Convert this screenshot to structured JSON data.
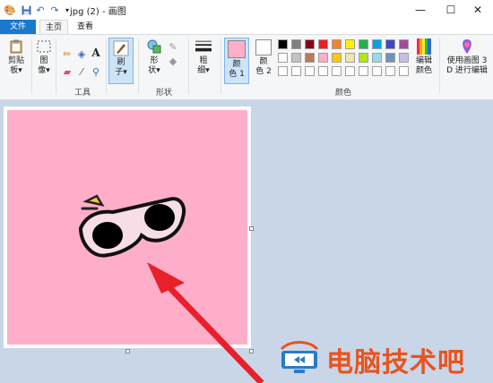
{
  "window": {
    "title": "jpg (2) - 画图",
    "quick_access": [
      "paint-app-icon",
      "save-icon",
      "undo-icon",
      "redo-icon",
      "customize-dropdown-icon"
    ]
  },
  "tabs": [
    {
      "label": "文件"
    },
    {
      "label": "主页"
    },
    {
      "label": "查看"
    }
  ],
  "ribbon": {
    "clipboard": {
      "paste_line1": "剪贴",
      "paste_line2": "板▾"
    },
    "image": {
      "line1": "图",
      "line2": "像▾"
    },
    "tools": {
      "label": "工具",
      "text_tool": "A"
    },
    "brushes": {
      "line1": "刷",
      "line2": "子▾"
    },
    "shapes": {
      "line1": "形",
      "line2": "状▾",
      "label": "形状"
    },
    "size": {
      "line1": "粗",
      "line2": "细▾"
    },
    "color1": {
      "line1": "颜",
      "line2": "色 1",
      "value": "#ffaec9"
    },
    "color2": {
      "line1": "颜",
      "line2": "色 2",
      "value": "#ffffff"
    },
    "colors_label": "颜色",
    "palette_row1": [
      "#000000",
      "#7f7f7f",
      "#880015",
      "#ed1c24",
      "#ff7f27",
      "#fff200",
      "#22b14c",
      "#00a2e8",
      "#3f48cc",
      "#a349a4"
    ],
    "palette_row2": [
      "#ffffff",
      "#c3c3c3",
      "#b97a57",
      "#ffaec9",
      "#ffc90e",
      "#efe4b0",
      "#b5e61d",
      "#99d9ea",
      "#7092be",
      "#c8bfe7"
    ],
    "palette_row3": [
      "#ffffff",
      "#ffffff",
      "#ffffff",
      "#ffffff",
      "#ffffff",
      "#ffffff",
      "#ffffff",
      "#ffffff",
      "#ffffff",
      "#ffffff"
    ],
    "edit_colors": {
      "line1": "编辑",
      "line2": "颜色"
    },
    "paint3d": {
      "line1": "使用画图 3",
      "line2": "D 进行编辑"
    }
  },
  "canvas": {
    "background": "#ffaec9"
  },
  "watermark": {
    "text": "电脑技术吧"
  }
}
